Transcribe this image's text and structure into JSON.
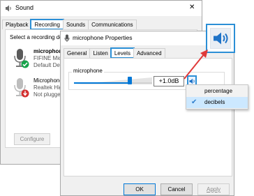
{
  "sound": {
    "title": "Sound",
    "close_glyph": "✕",
    "tabs": [
      "Playback",
      "Recording",
      "Sounds",
      "Communications"
    ],
    "instruction": "Select a recording device below to modify its settings:",
    "devices": [
      {
        "name": "microphone",
        "detail": "FIFINE Microphone",
        "status": "Default Device",
        "badge": "check"
      },
      {
        "name": "Microphone",
        "detail": "Realtek High Definition Audio",
        "status": "Not plugged in",
        "badge": "down"
      }
    ],
    "configure_label": "Configure"
  },
  "properties": {
    "title": "microphone Properties",
    "tabs": [
      "General",
      "Listen",
      "Levels",
      "Advanced"
    ],
    "level_group_label": "microphone",
    "level_value": "+1.0dB",
    "slider_fraction": 0.73,
    "ok_label": "OK",
    "cancel_label": "Cancel",
    "apply_label": "Apply"
  },
  "context_menu": {
    "items": [
      {
        "label": "percentage",
        "checked": false
      },
      {
        "label": "decibels",
        "checked": true
      }
    ]
  },
  "colors": {
    "accent": "#2b8fd6",
    "arrow": "#e03a3a",
    "speaker": "#1e73c8"
  }
}
